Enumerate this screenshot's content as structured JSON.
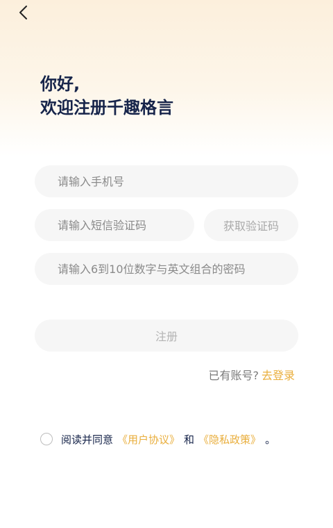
{
  "header": {
    "back_icon": "chevron-left-icon"
  },
  "greeting": {
    "line1": "你好,",
    "line2": "欢迎注册千趣格言"
  },
  "form": {
    "phone_placeholder": "请输入手机号",
    "code_placeholder": "请输入短信验证码",
    "get_code_label": "获取验证码",
    "password_placeholder": "请输入6到10位数字与英文组合的密码",
    "register_label": "注册"
  },
  "login": {
    "prompt": "已有账号?",
    "link": "去登录"
  },
  "agreement": {
    "prefix": "阅读并同意",
    "user_agreement": "《用户协议》",
    "and": "和",
    "privacy_policy": "《隐私政策》",
    "suffix": "。"
  },
  "colors": {
    "accent": "#e9ae3c",
    "heading": "#16244a",
    "field_bg": "#f6f6f6",
    "header_gradient": "#fcefdc"
  }
}
